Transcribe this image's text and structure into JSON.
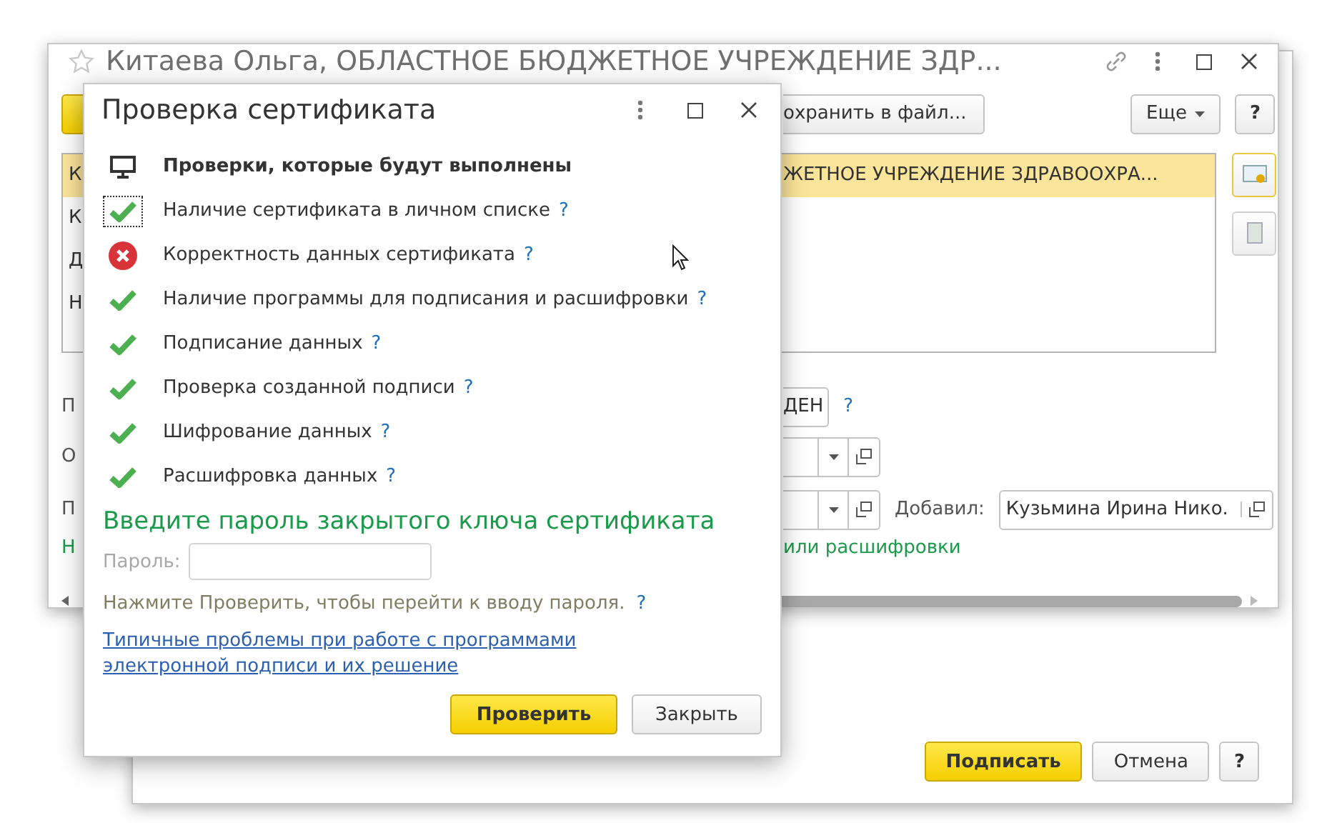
{
  "back_window": {
    "buttons": [
      {
        "label": "Подписать",
        "kind": "primary"
      },
      {
        "label": "Отмена",
        "kind": "default"
      },
      {
        "label": "?",
        "kind": "help"
      }
    ]
  },
  "main_window": {
    "title": "Китаева Ольга, ОБЛАСТНОЕ БЮДЖЕТНОЕ УЧРЕЖДЕНИЕ ЗДР...",
    "toolbar": {
      "save_button": "охранить в файл...",
      "more_button": "Еще",
      "help_button": "?"
    },
    "table": {
      "rows": [
        {
          "column_1": "К",
          "column_2": "ЖЕТНОЕ УЧРЕЖДЕНИЕ ЗДРАВООХРА...",
          "selected": true
        },
        {
          "column_1": "К",
          "selected": false
        },
        {
          "column_1": "Д",
          "selected": false
        },
        {
          "column_1": "Н",
          "selected": false
        }
      ]
    },
    "side_tools": [
      {
        "selected": true
      },
      {
        "selected": false
      }
    ],
    "form_rows": [
      {
        "kind": "text",
        "label": "П",
        "value": "ДЕН",
        "help": "?"
      },
      {
        "kind": "combo",
        "label": "О"
      },
      {
        "kind": "combo",
        "label": "П",
        "added_label": "Добавил:",
        "added_value": "Кузьмина Ирина Нико."
      },
      {
        "kind": "note",
        "label": "Н",
        "note": "или расшифровки"
      }
    ]
  },
  "dialog": {
    "title": "Проверка сертификата",
    "header": "Проверки, которые будут выполнены",
    "checks": [
      {
        "label": "Наличие сертификата в личном списке",
        "help": "?",
        "passed": true,
        "focused": true
      },
      {
        "label": "Корректность данных сертификата",
        "help": "?",
        "passed": false,
        "focused": false
      },
      {
        "label": "Наличие программы для подписания и расшифровки",
        "help": "?",
        "passed": true,
        "focused": false
      },
      {
        "label": "Подписание данных",
        "help": "?",
        "passed": true,
        "focused": false
      },
      {
        "label": "Проверка созданной подписи",
        "help": "?",
        "passed": true,
        "focused": false
      },
      {
        "label": "Шифрование данных",
        "help": "?",
        "passed": true,
        "focused": false
      },
      {
        "label": "Расшифровка данных",
        "help": "?",
        "passed": true,
        "focused": false
      }
    ],
    "password_title": "Введите пароль закрытого ключа сертификата",
    "password": {
      "label": "Пароль:",
      "disabled": true
    },
    "hint": "Нажмите Проверить, чтобы перейти к вводу пароля.",
    "hint_help": "?",
    "link": "Типичные проблемы при работе с программами электронной подписи и их решение",
    "buttons": [
      {
        "label": "Проверить",
        "kind": "primary"
      },
      {
        "label": "Закрыть",
        "kind": "default"
      }
    ]
  }
}
